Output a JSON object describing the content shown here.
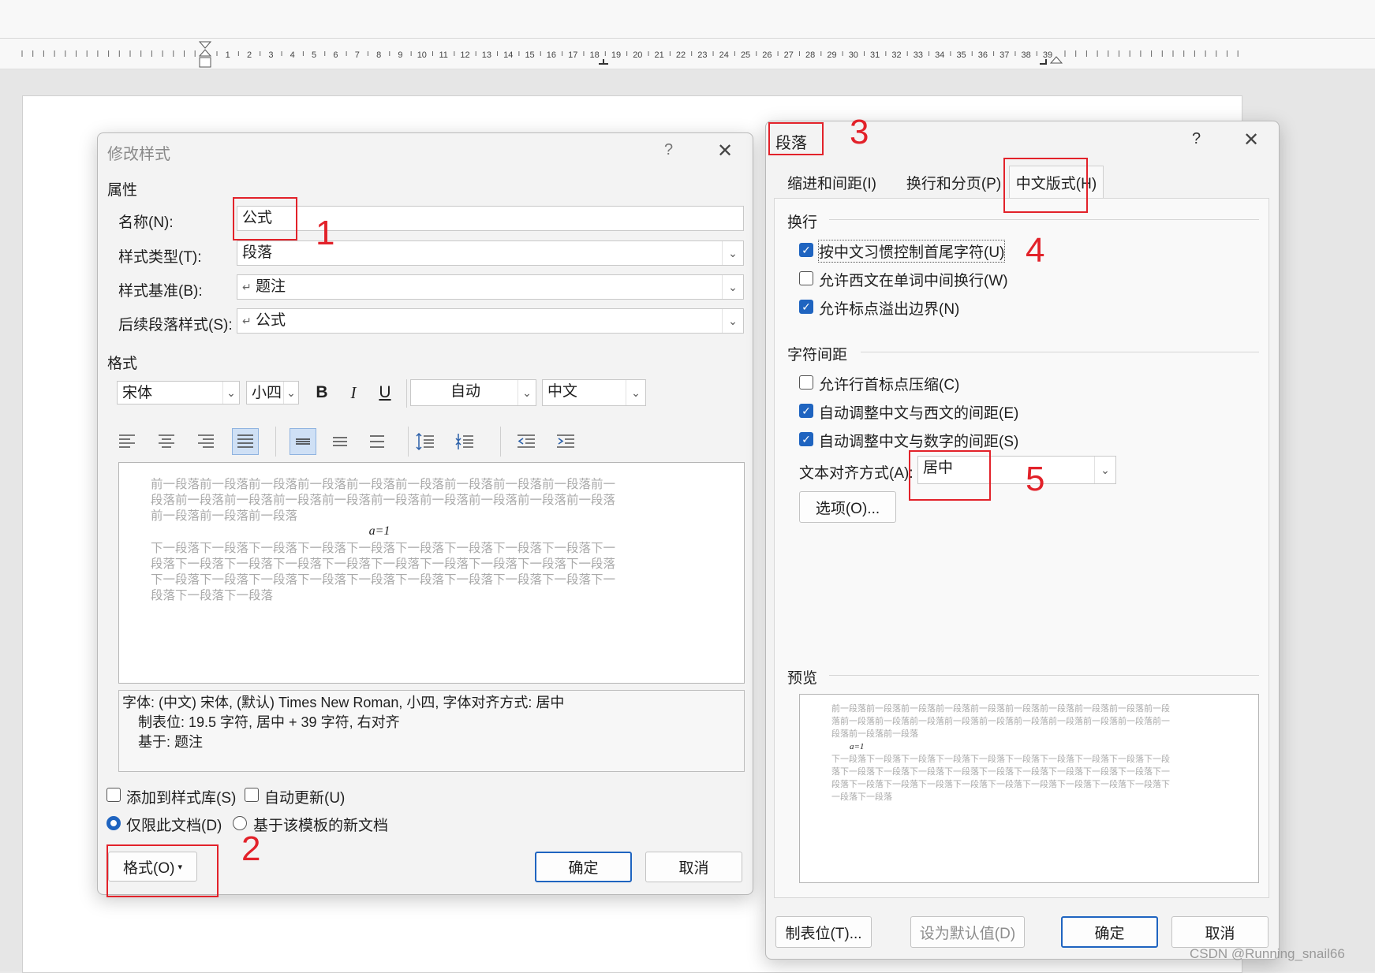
{
  "ruler": {
    "numbers": [
      "1",
      "2",
      "3",
      "4",
      "5",
      "6",
      "7",
      "8",
      "9",
      "10",
      "11",
      "12",
      "13",
      "14",
      "15",
      "16",
      "17",
      "18",
      "19",
      "20",
      "21",
      "22",
      "23",
      "24",
      "25",
      "26",
      "27",
      "28",
      "29",
      "30",
      "31",
      "32",
      "33",
      "34",
      "35",
      "36",
      "37",
      "38",
      "39"
    ]
  },
  "modify_style": {
    "title": "修改样式",
    "help": "?",
    "close": "✕",
    "properties_header": "属性",
    "name_label": "名称(N):",
    "name_value": "公式",
    "type_label": "样式类型(T):",
    "type_value": "段落",
    "base_label": "样式基准(B):",
    "base_value": "题注",
    "next_label": "后续段落样式(S):",
    "next_value": "公式",
    "paragraph_mark": "↵",
    "format_header": "格式",
    "font_value": "宋体",
    "size_value": "小四",
    "bold": "B",
    "italic": "I",
    "underline": "U",
    "color_value": "自动",
    "lang_value": "中文",
    "preview_prev": [
      "前一段落前一段落前一段落前一段落前一段落前一段落前一段落前一段落前一段落前一",
      "段落前一段落前一段落前一段落前一段落前一段落前一段落前一段落前一段落前一段落",
      "前一段落前一段落前一段落"
    ],
    "preview_formula": "a=1",
    "preview_next": [
      "下一段落下一段落下一段落下一段落下一段落下一段落下一段落下一段落下一段落下一",
      "段落下一段落下一段落下一段落下一段落下一段落下一段落下一段落下一段落下一段落",
      "下一段落下一段落下一段落下一段落下一段落下一段落下一段落下一段落下一段落下一",
      "段落下一段落下一段落"
    ],
    "desc_lines": [
      "字体: (中文) 宋体, (默认) Times New Roman, 小四, 字体对齐方式: 居中",
      "制表位:  19.5 字符, 居中 +  39 字符, 右对齐",
      "基于: 题注"
    ],
    "add_to_gallery": "添加到样式库(S)",
    "auto_update": "自动更新(U)",
    "only_this_doc": "仅限此文档(D)",
    "new_docs_template": "基于该模板的新文档",
    "format_button": "格式(O)",
    "ok": "确定",
    "cancel": "取消"
  },
  "paragraph": {
    "title": "段落",
    "help": "?",
    "close": "✕",
    "tabs": [
      "缩进和间距(I)",
      "换行和分页(P)",
      "中文版式(H)"
    ],
    "line_break_header": "换行",
    "opt1": "按中文习惯控制首尾字符(U)",
    "opt2": "允许西文在单词中间换行(W)",
    "opt3": "允许标点溢出边界(N)",
    "spacing_header": "字符间距",
    "opt4": "允许行首标点压缩(C)",
    "opt5": "自动调整中文与西文的间距(E)",
    "opt6": "自动调整中文与数字的间距(S)",
    "align_label": "文本对齐方式(A):",
    "align_value": "居中",
    "options_button": "选项(O)...",
    "preview_header": "预览",
    "preview_prev": [
      "前一段落前一段落前一段落前一段落前一段落前一段落前一段落前一段落前一段落前一段",
      "落前一段落前一段落前一段落前一段落前一段落前一段落前一段落前一段落前一段落前一",
      "段落前一段落前一段落"
    ],
    "preview_formula": "a=1",
    "preview_next": [
      "下一段落下一段落下一段落下一段落下一段落下一段落下一段落下一段落下一段落下一段",
      "落下一段落下一段落下一段落下一段落下一段落下一段落下一段落下一段落下一段落下一",
      "段落下一段落下一段落下一段落下一段落下一段落下一段落下一段落下一段落下一段落下",
      "一段落下一段落"
    ],
    "tabs_button": "制表位(T)...",
    "default_button": "设为默认值(D)",
    "ok": "确定",
    "cancel": "取消"
  },
  "annotations": [
    "1",
    "2",
    "3",
    "4",
    "5",
    "5"
  ],
  "watermark": "CSDN @Running_snail66",
  "colors": {
    "accent": "#1f64c0",
    "annotation": "#e2222a"
  }
}
